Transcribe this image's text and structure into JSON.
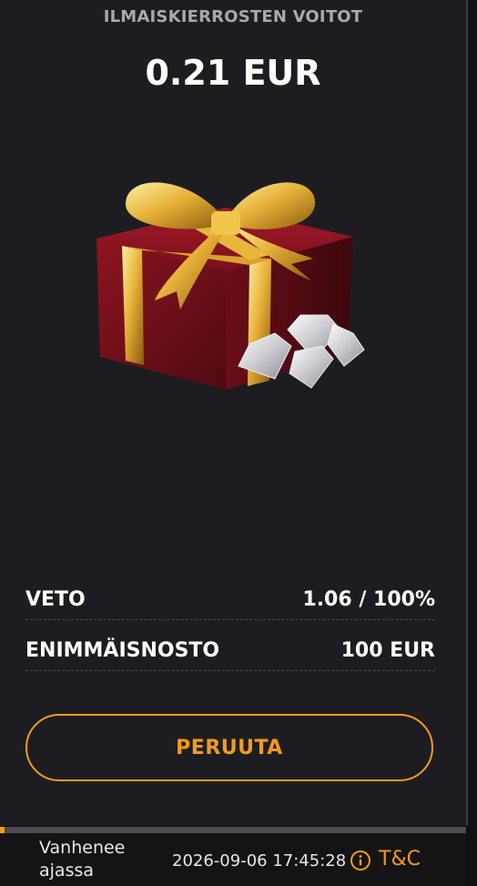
{
  "header": {
    "title": "ILMAISKIERROSTEN VOITOT",
    "amount": "0.21 EUR"
  },
  "details": {
    "wager_label": "VETO",
    "wager_value": "1.06 / 100%",
    "max_withdraw_label": "ENIMMÄISNOSTO",
    "max_withdraw_value": "100 EUR"
  },
  "actions": {
    "cancel_label": "PERUUTA"
  },
  "footer": {
    "expires_label": "Vanhenee ajassa",
    "expires_at": "2026-09-06 17:45:28",
    "terms_label": "T&C",
    "progress": 0.01
  },
  "icons": {
    "hero": "gift-box-with-diamonds-icon",
    "info": "info-icon"
  },
  "colors": {
    "accent": "#f39a1e",
    "card": "#1d1d21",
    "text_muted": "#a8a8ad"
  }
}
